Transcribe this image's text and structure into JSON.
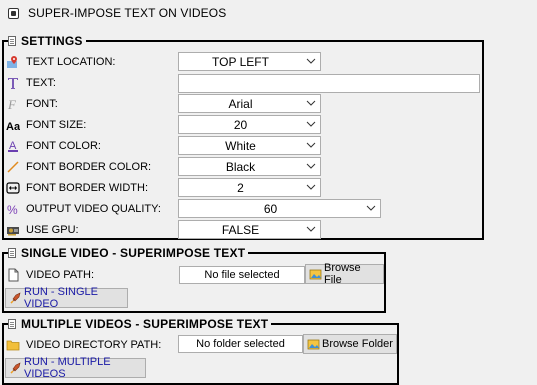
{
  "window": {
    "title": "SUPER-IMPOSE TEXT ON VIDEOS"
  },
  "settings": {
    "title": "SETTINGS",
    "rows": [
      {
        "label": "TEXT LOCATION:",
        "icon": "map-pin-icon",
        "value": "TOP LEFT"
      },
      {
        "label": "TEXT:",
        "icon": "text-tool-icon",
        "value": ""
      },
      {
        "label": "FONT:",
        "icon": "font-icon",
        "value": "Arial"
      },
      {
        "label": "FONT SIZE:",
        "icon": "font-size-icon",
        "value": "20"
      },
      {
        "label": "FONT COLOR:",
        "icon": "font-color-icon",
        "value": "White"
      },
      {
        "label": "FONT BORDER COLOR:",
        "icon": "line-icon",
        "value": "Black"
      },
      {
        "label": "FONT BORDER WIDTH:",
        "icon": "width-arrows-icon",
        "value": "2"
      },
      {
        "label": "OUTPUT VIDEO QUALITY:",
        "icon": "percent-icon",
        "value": "60"
      },
      {
        "label": "USE GPU:",
        "icon": "gpu-card-icon",
        "value": "FALSE"
      }
    ]
  },
  "single": {
    "title": "SINGLE VIDEO - SUPERIMPOSE TEXT",
    "path_label": "VIDEO PATH:",
    "path_value": "No file selected",
    "browse_label": "Browse File",
    "run_label": "RUN - SINGLE VIDEO"
  },
  "multiple": {
    "title": "MULTIPLE VIDEOS - SUPERIMPOSE TEXT",
    "path_label": "VIDEO DIRECTORY PATH:",
    "path_value": "No folder selected",
    "browse_label": "Browse Folder",
    "run_label": "RUN - MULTIPLE VIDEOS"
  },
  "colors": {
    "run_text": "#1a1aa6",
    "border": "#000000",
    "background": "#f0f0f0"
  }
}
